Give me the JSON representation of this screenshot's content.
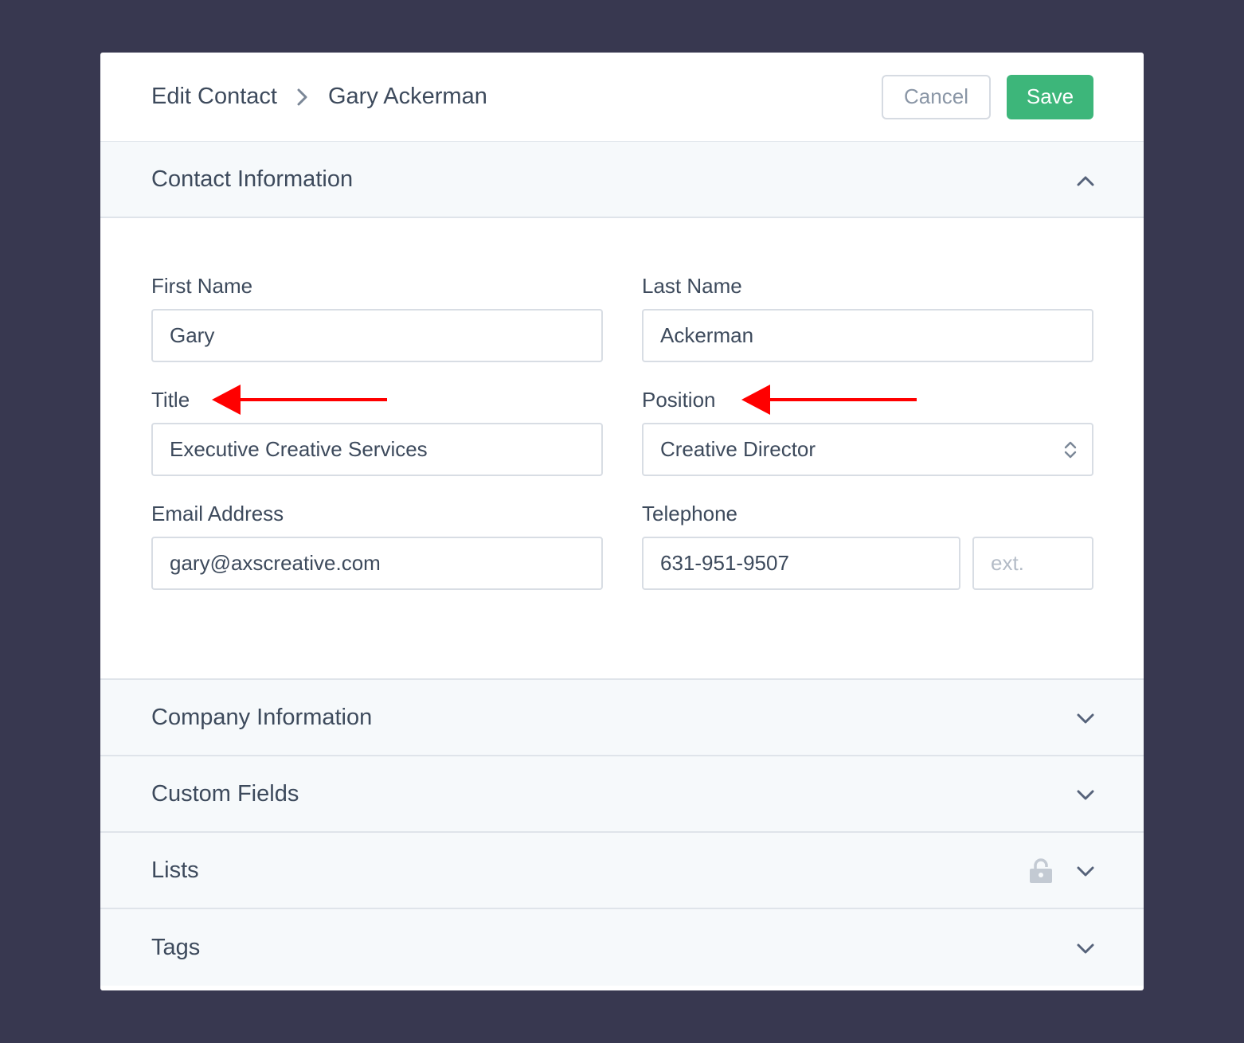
{
  "header": {
    "breadcrumb_root": "Edit Contact",
    "breadcrumb_current": "Gary Ackerman",
    "cancel_label": "Cancel",
    "save_label": "Save",
    "save_color": "#3db67a"
  },
  "contact_section": {
    "title": "Contact Information",
    "expanded": true,
    "fields": {
      "first_name": {
        "label": "First Name",
        "value": "Gary"
      },
      "last_name": {
        "label": "Last Name",
        "value": "Ackerman"
      },
      "title": {
        "label": "Title",
        "value": "Executive Creative Services"
      },
      "position": {
        "label": "Position",
        "value": "Creative Director"
      },
      "email": {
        "label": "Email Address",
        "value": "gary@axscreative.com"
      },
      "telephone": {
        "label": "Telephone",
        "value": "631-951-9507",
        "ext_placeholder": "ext."
      }
    },
    "annotation_color": "#ff0000"
  },
  "sections": [
    {
      "title": "Company Information",
      "locked": false
    },
    {
      "title": "Custom Fields",
      "locked": false
    },
    {
      "title": "Lists",
      "locked": true
    },
    {
      "title": "Tags",
      "locked": false
    }
  ],
  "icons": {
    "breadcrumb_separator": "chevron-right-icon",
    "collapse": "chevron-up-icon",
    "expand": "chevron-down-icon",
    "select": "select-arrows-icon",
    "lock": "lock-icon",
    "annotation": "arrow-left-icon"
  }
}
